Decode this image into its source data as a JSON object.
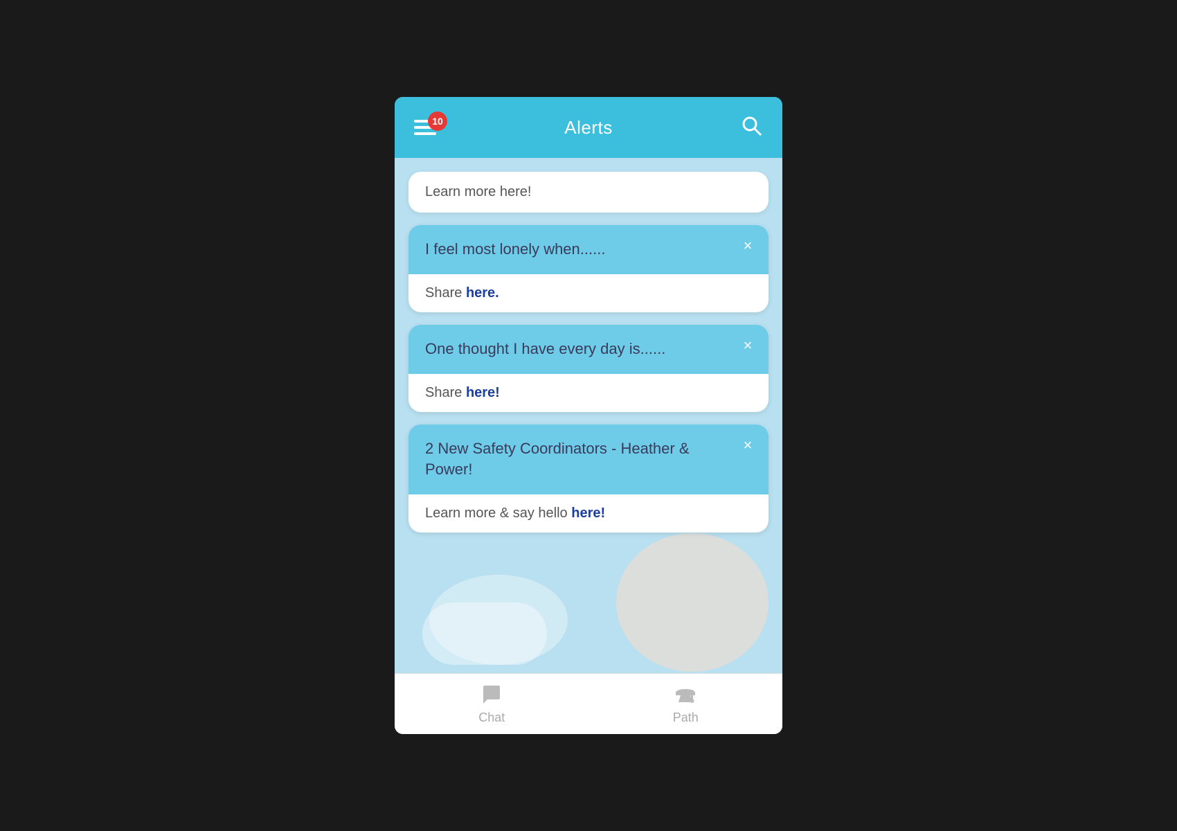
{
  "header": {
    "title": "Alerts",
    "badge_count": "10"
  },
  "cards": [
    {
      "id": "card-learn-more",
      "has_close": false,
      "title": null,
      "body_prefix": "Learn more ",
      "body_link": "here!",
      "link_style": "bold"
    },
    {
      "id": "card-lonely",
      "has_close": true,
      "title": "I feel most lonely when......",
      "body_prefix": "Share ",
      "body_link": "here.",
      "link_style": "bold"
    },
    {
      "id": "card-thought",
      "has_close": true,
      "title": "One thought I have every day is......",
      "body_prefix": "Share ",
      "body_link": "here!",
      "link_style": "bold"
    },
    {
      "id": "card-safety",
      "has_close": true,
      "title": "2 New Safety Coordinators - Heather & Power!",
      "body_prefix": "Learn more & say hello ",
      "body_link": "here!",
      "link_style": "bold"
    }
  ],
  "nav": {
    "chat_label": "Chat",
    "path_label": "Path"
  },
  "close_symbol": "×"
}
